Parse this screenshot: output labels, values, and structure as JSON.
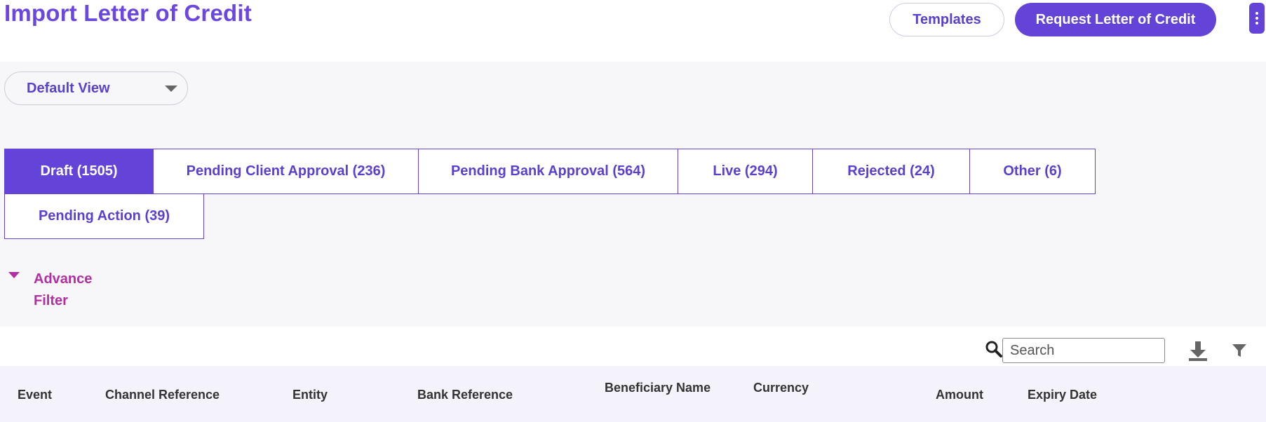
{
  "header": {
    "title": "Import Letter of Credit",
    "templates_label": "Templates",
    "request_label": "Request Letter of Credit",
    "more_icon": "kebab-menu-icon"
  },
  "view_selector": {
    "selected": "Default View",
    "icon": "caret-down-icon"
  },
  "tabs": [
    {
      "label": "Draft (1505)",
      "active": true
    },
    {
      "label": "Pending Client Approval (236)",
      "active": false
    },
    {
      "label": "Pending Bank Approval (564)",
      "active": false
    },
    {
      "label": "Live (294)",
      "active": false
    },
    {
      "label": "Rejected (24)",
      "active": false
    },
    {
      "label": "Other (6)",
      "active": false
    },
    {
      "label": "Pending Action (39)",
      "active": false
    }
  ],
  "advance_filter": {
    "label": "Advance Filter",
    "icon": "caret-down-icon"
  },
  "toolbar": {
    "search_placeholder": "Search",
    "search_icon": "search-icon",
    "download_icon": "download-icon",
    "filter_icon": "filter-icon"
  },
  "table": {
    "columns": [
      "Event",
      "Channel Reference",
      "Entity",
      "Bank Reference",
      "Beneficiary Name",
      "Currency",
      "Amount",
      "Expiry Date"
    ]
  },
  "colors": {
    "primary": "#6443d8",
    "accent_magenta": "#b22fa3",
    "panel_bg": "#f7f6f9"
  }
}
